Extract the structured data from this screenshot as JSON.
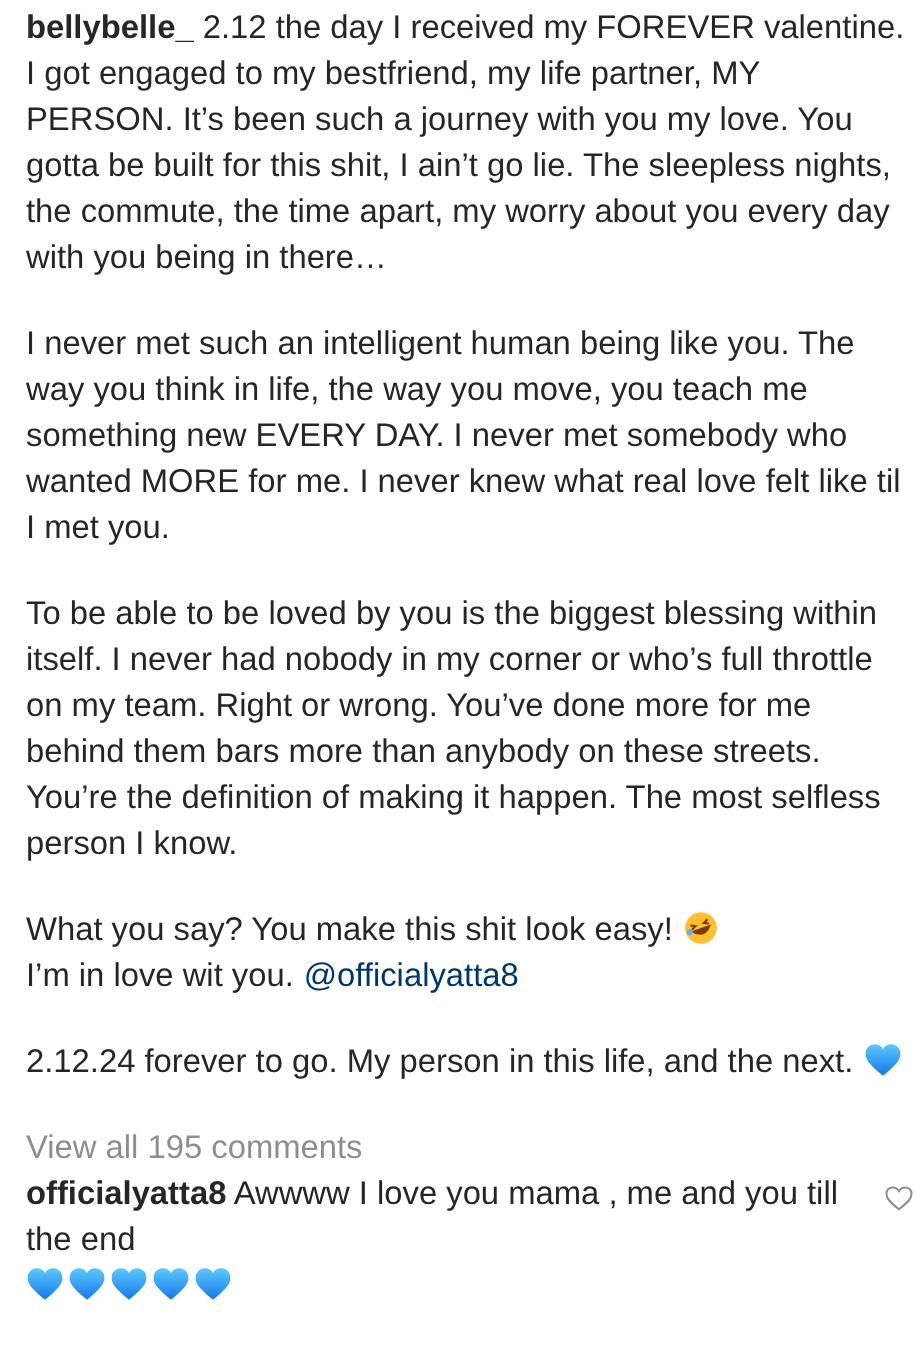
{
  "post": {
    "paragraphs": [
      [
        {
          "kind": "text",
          "text": "**bellybelle_** 2.12 the day I received my FOREVER valentine. I got engaged to my bestfriend, my life partner, MY PERSON. It’s been such a journey with you my love. You gotta be built for this shit, I ain’t go lie. The sleepless nights, the commute, the time apart, my worry about you every day with you being in there…"
        }
      ],
      [
        {
          "kind": "text",
          "text": "I never met such an intelligent human being like you. The way you think in life, the way you move, you teach me something new EVERY DAY. I never met somebody who wanted MORE for me. I never knew what real love felt like til I met you."
        }
      ],
      [
        {
          "kind": "text",
          "text": "To be able to be loved by you is the biggest blessing within itself. I never had nobody in my corner or who’s full throttle on my team. Right or wrong. You’ve done more for me behind them bars more than anybody on these streets. You’re the definition of making it happen. The most selfless person I know."
        }
      ],
      [
        {
          "kind": "text",
          "text": "What you say? You make this shit look easy!"
        },
        {
          "kind": "laugh"
        },
        {
          "kind": "text",
          "text": "I’m in love wit you."
        },
        {
          "kind": "mention",
          "text": "@officialyatta8"
        }
      ],
      [
        {
          "kind": "text",
          "text": "2.12.24 forever to go. My person in this life, and the next."
        },
        {
          "kind": "heart"
        }
      ]
    ]
  },
  "view_comments": "View all 195 comments",
  "comment": {
    "parts": [
      {
        "kind": "text",
        "text": "**officialyatta8** Awwww I love you mama , me and you till the end"
      },
      {
        "kind": "heart"
      },
      {
        "kind": "heart"
      },
      {
        "kind": "heart"
      },
      {
        "kind": "heart"
      },
      {
        "kind": "heart"
      }
    ],
    "liked": false
  }
}
